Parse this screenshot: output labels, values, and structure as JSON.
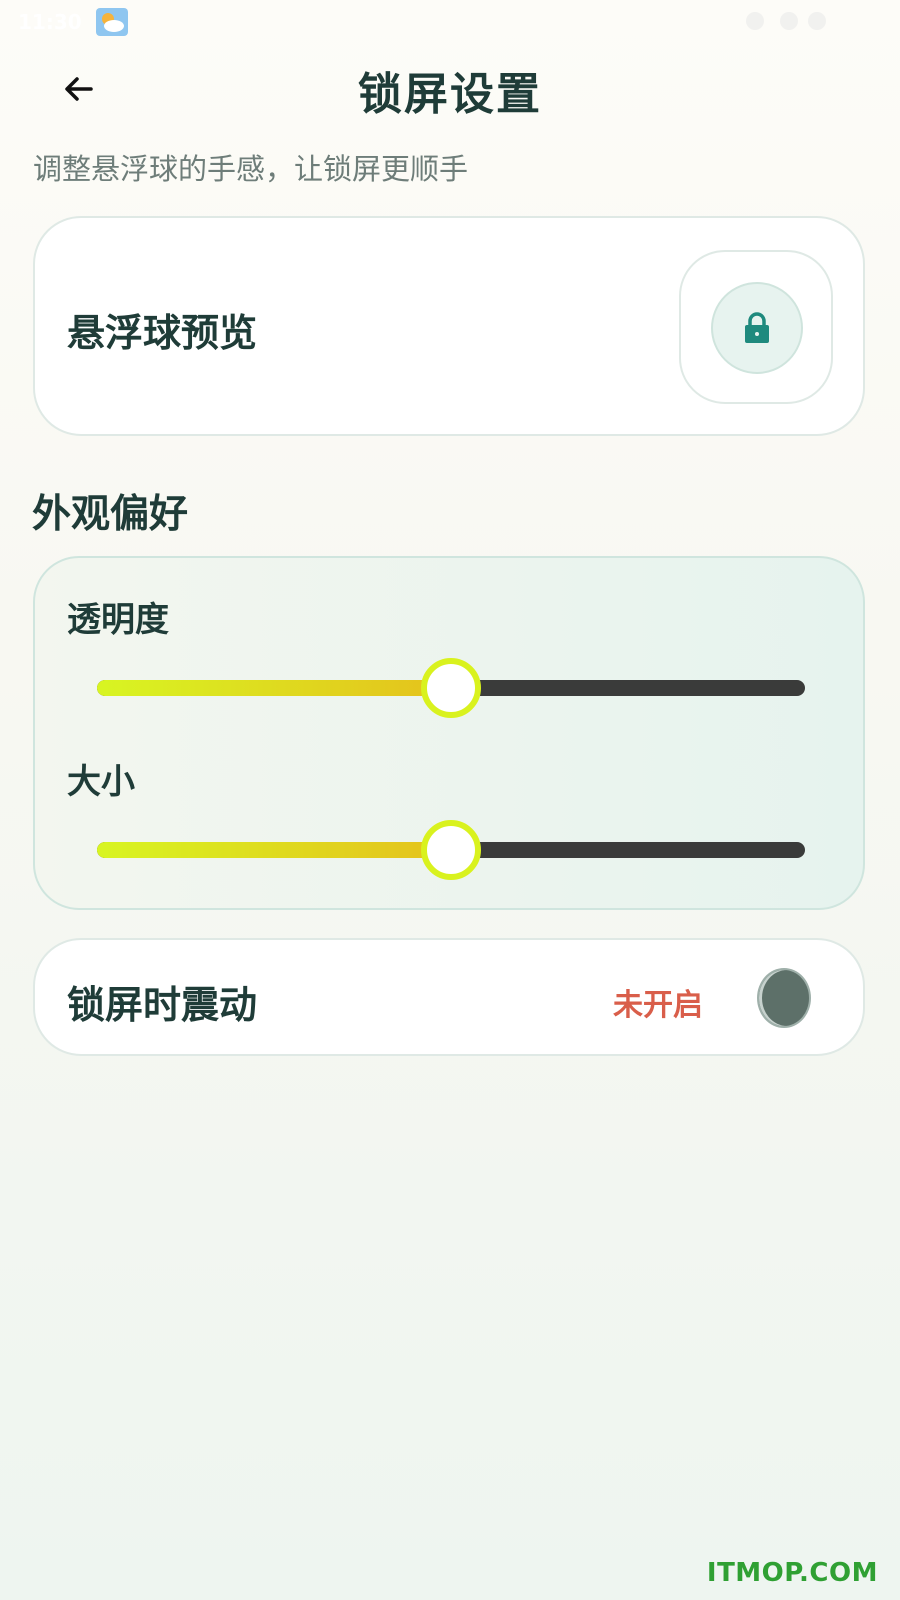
{
  "status_bar": {
    "time": "11:30",
    "weather_icon": "partly-cloudy-icon"
  },
  "header": {
    "back_icon": "arrow-left-icon",
    "title": "锁屏设置",
    "subtitle": "调整悬浮球的手感，让锁屏更顺手"
  },
  "preview_card": {
    "label": "悬浮球预览",
    "ball_icon": "lock-icon",
    "accent_color": "#1f8a7e"
  },
  "appearance": {
    "section_title": "外观偏好",
    "sliders": [
      {
        "label": "透明度",
        "value_fraction": 0.5
      },
      {
        "label": "大小",
        "value_fraction": 0.5
      }
    ],
    "fill_gradient_colors": [
      "#d8f522",
      "#e5c11c"
    ],
    "thumb_color": "#d9f21e"
  },
  "vibration": {
    "label": "锁屏时震动",
    "status": "未开启",
    "status_color": "#d95e4a",
    "enabled": false
  },
  "watermark": "ITMOP.COM"
}
